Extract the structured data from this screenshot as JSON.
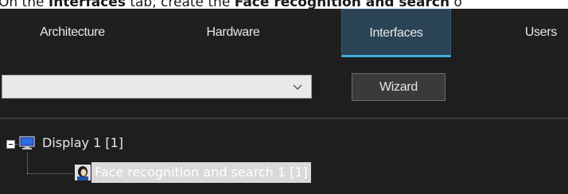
{
  "instruction": {
    "prefix": "On the ",
    "tab_name": "Interfaces",
    "middle": " tab, create the ",
    "object_name": "Face recognition and search",
    "suffix": " o"
  },
  "tabs": [
    {
      "label": "Architecture",
      "active": false
    },
    {
      "label": "Hardware",
      "active": false
    },
    {
      "label": "Interfaces",
      "active": true
    },
    {
      "label": "Users",
      "active": false
    }
  ],
  "toolbar": {
    "combo_value": "",
    "combo_icon": "chevron-down-icon",
    "wizard_label": "Wizard"
  },
  "tree": {
    "items": [
      {
        "label": "Display 1 [1]",
        "icon": "monitor-icon",
        "expanded": true
      },
      {
        "label": "Face recognition and search 1 [1]",
        "icon": "face-icon",
        "selected": true
      }
    ]
  },
  "colors": {
    "background": "#1e1e1e",
    "active_tab": "#2a4355",
    "active_tab_underline": "#3db0e0",
    "selection": "#d9d9d9"
  }
}
